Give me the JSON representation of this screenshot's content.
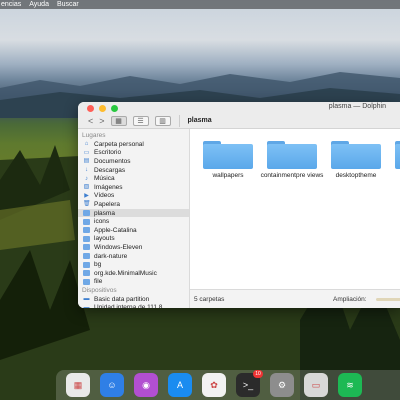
{
  "menubar": {
    "items": [
      "encias",
      "Ayuda",
      "Buscar"
    ]
  },
  "window": {
    "title": "plasma — Dolphin",
    "toolbar": {
      "back": "<",
      "forward": ">",
      "view_icons": "▦",
      "view_list": "☰",
      "view_columns": "▥",
      "breadcrumb": "plasma"
    },
    "sidebar": {
      "places_header": "Lugares",
      "places": [
        {
          "label": "Carpeta personal",
          "icon": "home-icon"
        },
        {
          "label": "Escritorio",
          "icon": "desktop-icon"
        },
        {
          "label": "Documentos",
          "icon": "documents-icon"
        },
        {
          "label": "Descargas",
          "icon": "downloads-icon"
        },
        {
          "label": "Música",
          "icon": "music-icon"
        },
        {
          "label": "Imágenes",
          "icon": "pictures-icon"
        },
        {
          "label": "Vídeos",
          "icon": "videos-icon"
        },
        {
          "label": "Papelera",
          "icon": "trash-icon"
        },
        {
          "label": "plasma",
          "icon": "folder-icon"
        },
        {
          "label": "icons",
          "icon": "folder-icon"
        },
        {
          "label": "Apple-Catalina",
          "icon": "folder-icon"
        },
        {
          "label": "layouts",
          "icon": "folder-icon"
        },
        {
          "label": "Windows-Eleven",
          "icon": "folder-icon"
        },
        {
          "label": "dark-nature",
          "icon": "folder-icon"
        },
        {
          "label": "bg",
          "icon": "folder-icon"
        },
        {
          "label": "org.kde.MinimalMusic",
          "icon": "folder-icon"
        },
        {
          "label": "file",
          "icon": "folder-icon"
        }
      ],
      "devices_header": "Dispositivos",
      "devices": [
        {
          "label": "Basic data partition",
          "icon": "drive-icon"
        },
        {
          "label": "Unidad interna de 111,8...",
          "icon": "drive-icon"
        }
      ]
    },
    "files": [
      {
        "label": "wallpapers"
      },
      {
        "label": "containmentpre views"
      },
      {
        "label": "desktoptheme"
      },
      {
        "label": ""
      }
    ],
    "status": {
      "count": "5 carpetas",
      "zoom_label": "Ampliación:"
    }
  },
  "dock": {
    "apps": [
      {
        "name": "launchpad-icon",
        "color": "#e9e9e9"
      },
      {
        "name": "finder-icon",
        "color": "#2f7fe6"
      },
      {
        "name": "firefox-icon",
        "color": "#b24fd1"
      },
      {
        "name": "app-store-icon",
        "color": "#1a8cf0"
      },
      {
        "name": "photos-icon",
        "color": "#f2f2f2"
      },
      {
        "name": "terminal-icon",
        "color": "#2b2b2b",
        "badge": "10"
      },
      {
        "name": "settings-icon",
        "color": "#8d8d8d"
      },
      {
        "name": "screen-icon",
        "color": "#d8d8d8"
      },
      {
        "name": "spotify-icon",
        "color": "#1db954"
      }
    ]
  },
  "colors": {
    "accent": "#5aa8ea",
    "selection": "#dcdcdc"
  }
}
